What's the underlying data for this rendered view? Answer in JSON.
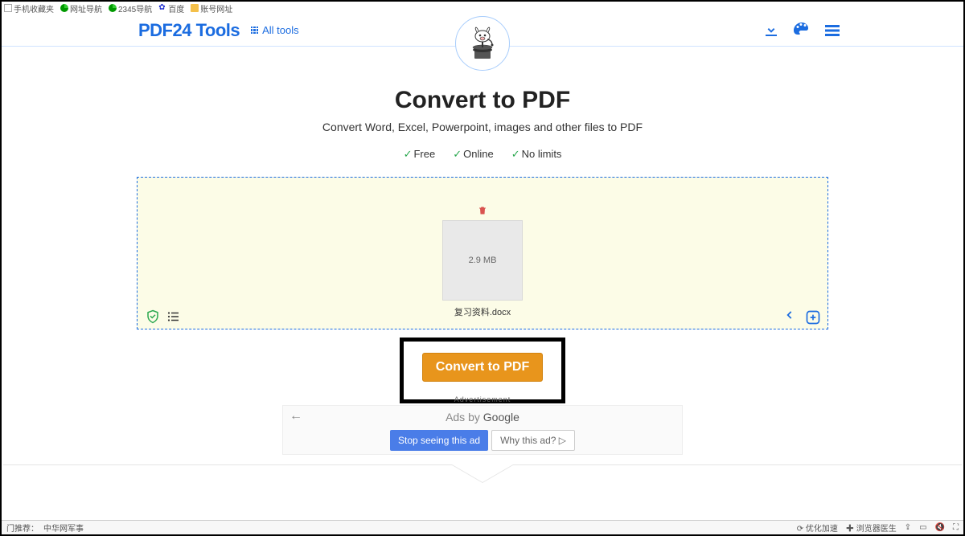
{
  "bookmarks": {
    "favorites": "手机收藏夹",
    "nav1": "网址导航",
    "nav2": "2345导航",
    "baidu": "百度",
    "accounts": "账号网址"
  },
  "header": {
    "brand": "PDF24 Tools",
    "all_tools": "All tools"
  },
  "page": {
    "title": "Convert to PDF",
    "subtitle": "Convert Word, Excel, Powerpoint, images and other files to PDF",
    "badge_free": "Free",
    "badge_online": "Online",
    "badge_nolimits": "No limits"
  },
  "file": {
    "size": "2.9 MB",
    "name": "复习资料.docx"
  },
  "actions": {
    "convert": "Convert to PDF"
  },
  "ad": {
    "advertisement": "Advertisement",
    "ads_by": "Ads by ",
    "google": "Google",
    "stop": "Stop seeing this ad",
    "why": "Why this ad? ▷"
  },
  "status": {
    "recommend_label": "门推荐：",
    "recommend_link": "中华网军事",
    "speedup": "优化加速",
    "doctor": "浏览器医生"
  }
}
